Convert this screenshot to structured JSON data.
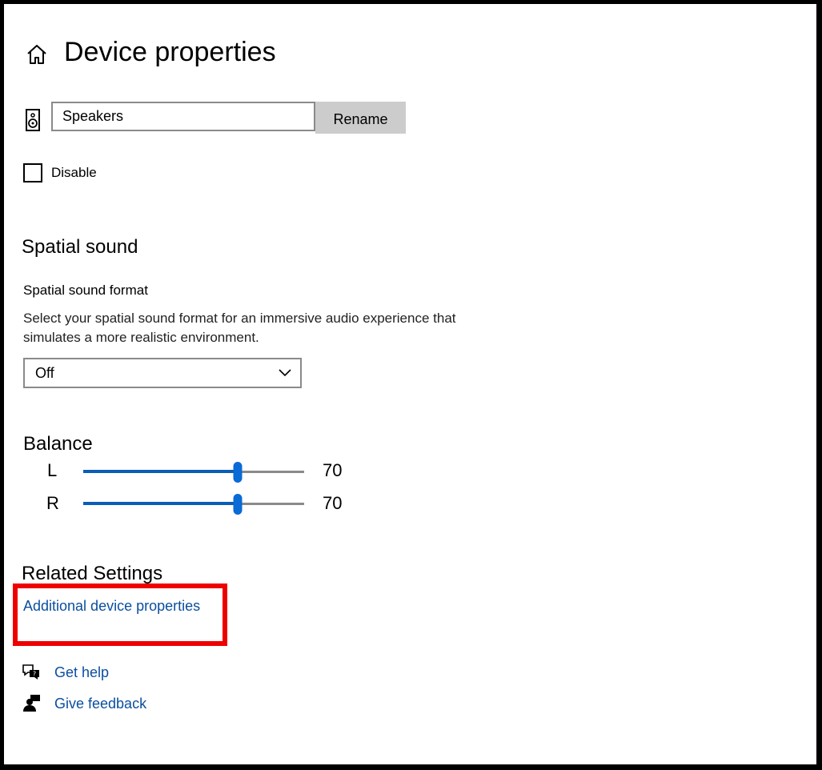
{
  "header": {
    "title": "Device properties",
    "icon": "home-icon"
  },
  "device": {
    "icon": "speaker-icon",
    "name_value": "Speakers",
    "rename_label": "Rename"
  },
  "disable": {
    "label": "Disable",
    "checked": false
  },
  "spatial": {
    "title": "Spatial sound",
    "format_label": "Spatial sound format",
    "description": "Select your spatial sound format for an immersive audio experience that simulates a more realistic environment.",
    "selected": "Off"
  },
  "balance": {
    "title": "Balance",
    "channels": [
      {
        "label": "L",
        "value": 70,
        "value_text": "70"
      },
      {
        "label": "R",
        "value": 70,
        "value_text": "70"
      }
    ],
    "accent_color": "#0a6ad6"
  },
  "related": {
    "title": "Related Settings",
    "link": "Additional device properties",
    "highlight_color": "#ee0000"
  },
  "support": {
    "help_label": "Get help",
    "help_icon": "chat-help-icon",
    "feedback_label": "Give feedback",
    "feedback_icon": "feedback-person-icon"
  }
}
